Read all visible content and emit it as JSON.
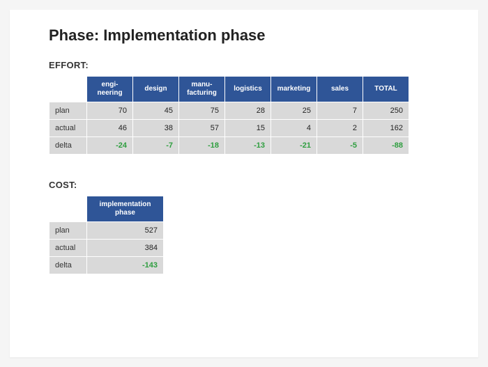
{
  "title": "Phase: Implementation phase",
  "effort": {
    "label": "EFFORT:",
    "columns": [
      "engi-\nneering",
      "design",
      "manu-\nfacturing",
      "logistics",
      "marketing",
      "sales",
      "TOTAL"
    ],
    "rows": [
      {
        "label": "plan",
        "values": [
          "70",
          "45",
          "75",
          "28",
          "25",
          "7",
          "250"
        ],
        "delta": false
      },
      {
        "label": "actual",
        "values": [
          "46",
          "38",
          "57",
          "15",
          "4",
          "2",
          "162"
        ],
        "delta": false
      },
      {
        "label": "delta",
        "values": [
          "-24",
          "-7",
          "-18",
          "-13",
          "-21",
          "-5",
          "-88"
        ],
        "delta": true
      }
    ]
  },
  "cost": {
    "label": "COST:",
    "columns": [
      "implementation\nphase"
    ],
    "rows": [
      {
        "label": "plan",
        "values": [
          "527"
        ],
        "delta": false
      },
      {
        "label": "actual",
        "values": [
          "384"
        ],
        "delta": false
      },
      {
        "label": "delta",
        "values": [
          "-143"
        ],
        "delta": true
      }
    ]
  },
  "chart_data": [
    {
      "type": "table",
      "title": "EFFORT",
      "categories": [
        "engineering",
        "design",
        "manufacturing",
        "logistics",
        "marketing",
        "sales",
        "TOTAL"
      ],
      "series": [
        {
          "name": "plan",
          "values": [
            70,
            45,
            75,
            28,
            25,
            7,
            250
          ]
        },
        {
          "name": "actual",
          "values": [
            46,
            38,
            57,
            15,
            4,
            2,
            162
          ]
        },
        {
          "name": "delta",
          "values": [
            -24,
            -7,
            -18,
            -13,
            -21,
            -5,
            -88
          ]
        }
      ]
    },
    {
      "type": "table",
      "title": "COST",
      "categories": [
        "implementation phase"
      ],
      "series": [
        {
          "name": "plan",
          "values": [
            527
          ]
        },
        {
          "name": "actual",
          "values": [
            384
          ]
        },
        {
          "name": "delta",
          "values": [
            -143
          ]
        }
      ]
    }
  ]
}
